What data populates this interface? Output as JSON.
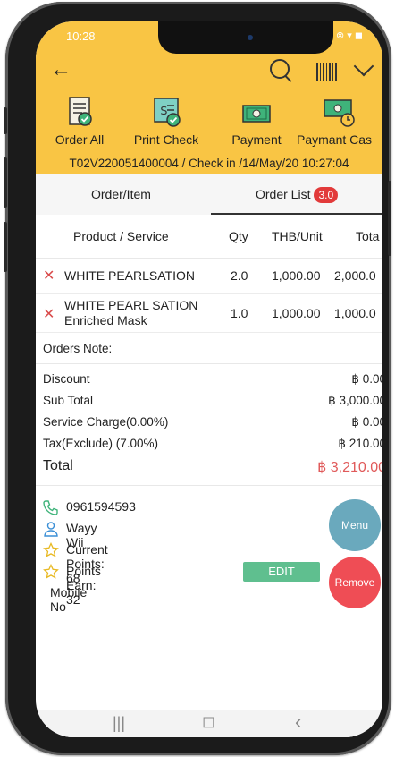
{
  "status": {
    "time": "10:28",
    "icons": "N ⊗ ▾ ◼"
  },
  "header": {
    "actions": [
      {
        "label": "Order All"
      },
      {
        "label": "Print Check"
      },
      {
        "label": "Payment"
      },
      {
        "label": "Paymant Cas"
      }
    ],
    "checkin": "T02V220051400004 / Check in /14/May/20 10:27:04"
  },
  "tabs": {
    "order_item": "Order/Item",
    "order_list": "Order List",
    "order_list_badge": "3.0"
  },
  "table": {
    "headers": {
      "product": "Product / Service",
      "qty": "Qty",
      "unit": "THB/Unit",
      "total": "Tota"
    },
    "rows": [
      {
        "name": "WHITE PEARLSATION",
        "name2": "",
        "qty": "2.0",
        "unit": "1,000.00",
        "total": "2,000.0"
      },
      {
        "name": "WHITE PEARL SATION",
        "name2": "Enriched  Mask",
        "qty": "1.0",
        "unit": "1,000.00",
        "total": "1,000.0"
      }
    ]
  },
  "orders_note": "Orders Note:",
  "summary": {
    "discount_label": "Discount",
    "discount_value": "฿ 0.00",
    "subtotal_label": "Sub Total",
    "subtotal_value": "฿ 3,000.00",
    "service_label": "Service Charge(0.00%)",
    "service_value": "฿ 0.00",
    "tax_label": "Tax(Exclude) (7.00%)",
    "tax_value": "฿ 210.00",
    "total_label": "Total",
    "total_value": "฿ 3,210.00"
  },
  "customer": {
    "phone": "0961594593",
    "name": "Wayy Wii",
    "current_points": "Current Points: 68",
    "points_earn": "Points Earn: 32",
    "mobile_label": "Mobile No"
  },
  "buttons": {
    "edit": "EDIT",
    "menu": "Menu",
    "remove": "Remove"
  },
  "navbar": {
    "recents": "|||",
    "home": "◻",
    "back": "‹"
  },
  "colors": {
    "header": "#f9c544",
    "badge": "#e23a3a",
    "total": "#e05a5a",
    "edit": "#5fbf8f",
    "menu": "#6aa9bd",
    "remove": "#ef4d55"
  }
}
